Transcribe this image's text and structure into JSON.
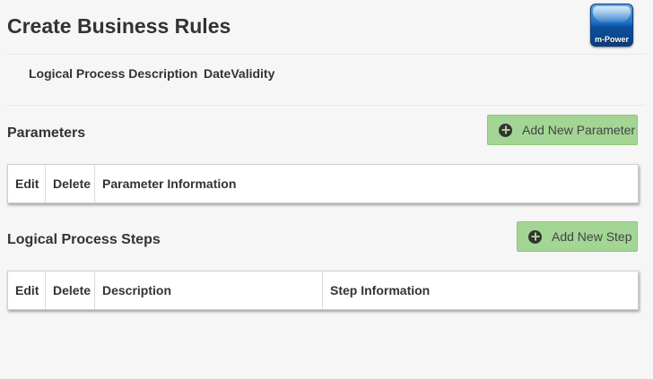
{
  "header": {
    "title": "Create Business Rules",
    "logo_text": "m-Power"
  },
  "info": {
    "logical_process_description_label": "Logical Process Description",
    "logical_process_description_value": "DateValidity"
  },
  "parameters": {
    "title": "Parameters",
    "add_button_label": "Add New Parameter",
    "columns": [
      "Edit",
      "Delete",
      "Parameter Information"
    ]
  },
  "steps": {
    "title": "Logical Process Steps",
    "add_button_label": "Add New Step",
    "columns": [
      "Edit",
      "Delete",
      "Description",
      "Step Information"
    ]
  },
  "colors": {
    "button_bg": "#a3d595",
    "page_bg": "#f6f6f6",
    "logo_blue": "#1b6dc1"
  }
}
